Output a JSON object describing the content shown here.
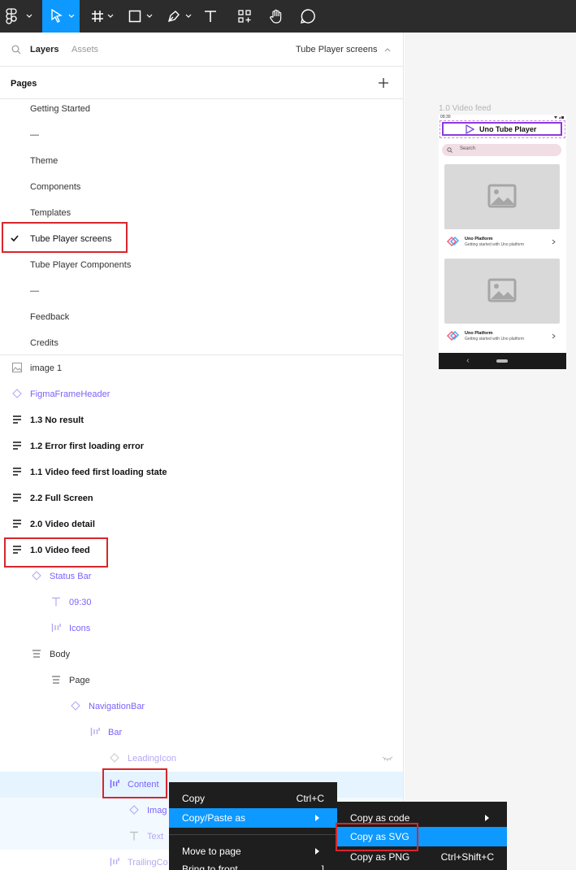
{
  "tabs": {
    "layers": "Layers",
    "assets": "Assets",
    "page_selector": "Tube Player screens"
  },
  "pages": {
    "header": "Pages",
    "items": [
      {
        "label": "Getting Started"
      },
      {
        "label": "—"
      },
      {
        "label": "Theme"
      },
      {
        "label": "Components"
      },
      {
        "label": "Templates"
      },
      {
        "label": "Tube Player screens",
        "selected": true
      },
      {
        "label": "Tube Player Components"
      },
      {
        "label": "—"
      },
      {
        "label": "Feedback"
      },
      {
        "label": "Credits"
      }
    ]
  },
  "layers": [
    {
      "label": "image 1",
      "icon": "image-icon"
    },
    {
      "label": "FigmaFrameHeader",
      "icon": "component-instance-icon"
    },
    {
      "label": "1.3 No result",
      "icon": "frame-rows-icon"
    },
    {
      "label": "1.2 Error first loading error",
      "icon": "frame-rows-icon"
    },
    {
      "label": "1.1 Video feed first loading state",
      "icon": "frame-rows-icon"
    },
    {
      "label": "2.2 Full Screen",
      "icon": "frame-rows-icon"
    },
    {
      "label": "2.0 Video detail",
      "icon": "frame-rows-icon"
    },
    {
      "label": "1.0 Video feed",
      "icon": "frame-rows-icon"
    },
    {
      "label": "Status Bar",
      "icon": "component-instance-icon"
    },
    {
      "label": "09:30",
      "icon": "text-icon"
    },
    {
      "label": "Icons",
      "icon": "auto-layout-horizontal-icon"
    },
    {
      "label": "Body",
      "icon": "auto-layout-vertical-icon"
    },
    {
      "label": "Page",
      "icon": "auto-layout-vertical-icon"
    },
    {
      "label": "NavigationBar",
      "icon": "component-instance-icon"
    },
    {
      "label": "Bar",
      "icon": "auto-layout-horizontal-icon"
    },
    {
      "label": "LeadingIcon",
      "icon": "component-instance-icon"
    },
    {
      "label": "Content",
      "icon": "auto-layout-horizontal-icon"
    },
    {
      "label": "Imag",
      "icon": "component-instance-icon"
    },
    {
      "label": "Text",
      "icon": "text-icon"
    },
    {
      "label": "TrailingCo",
      "icon": "auto-layout-horizontal-icon"
    }
  ],
  "canvas": {
    "frame_label": "1.0 Video feed",
    "status_time": "09:30",
    "app_title": "Uno Tube Player",
    "search_placeholder": "Search",
    "cards": [
      {
        "channel": "Uno Platform",
        "subtitle": "Getting started with Uno platform"
      },
      {
        "channel": "Uno Platform",
        "subtitle": "Getting started with Uno platform"
      }
    ]
  },
  "context_menu": {
    "items": [
      {
        "label": "Copy",
        "shortcut": "Ctrl+C"
      },
      {
        "label": "Copy/Paste as",
        "submenu": true
      },
      {
        "label": "Move to page",
        "submenu": true
      },
      {
        "label": "Bring to front",
        "shortcut": "]"
      }
    ]
  },
  "submenu": {
    "items": [
      {
        "label": "Copy as code",
        "submenu": true
      },
      {
        "label": "Copy as SVG"
      },
      {
        "label": "Copy as PNG",
        "shortcut": "Ctrl+Shift+C"
      }
    ]
  },
  "colors": {
    "accent": "#0d99ff",
    "component": "#7b61ff",
    "toolbar": "#2c2c2c",
    "menu": "#1e1e1e",
    "highlight_box": "#d7262d"
  }
}
